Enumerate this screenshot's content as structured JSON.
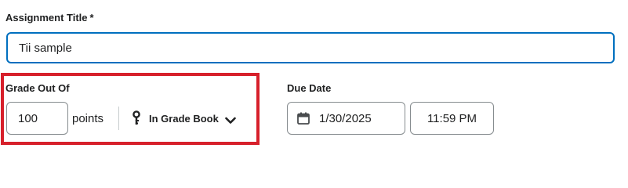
{
  "assignment_title": {
    "label": "Assignment Title",
    "required_marker": "*",
    "value": "Tii sample"
  },
  "grade": {
    "label": "Grade Out Of",
    "points_value": "100",
    "unit": "points",
    "gradebook_button": {
      "label": "In Grade Book",
      "icon": "key-icon",
      "dropdown_icon": "chevron-down-icon"
    }
  },
  "due_date": {
    "label": "Due Date",
    "date_value": "1/30/2025",
    "date_icon": "calendar-icon",
    "time_value": "11:59 PM"
  },
  "colors": {
    "focus_border": "#006fbf",
    "highlight": "#d7202b",
    "input_border": "#868c8f",
    "text": "#202122"
  }
}
